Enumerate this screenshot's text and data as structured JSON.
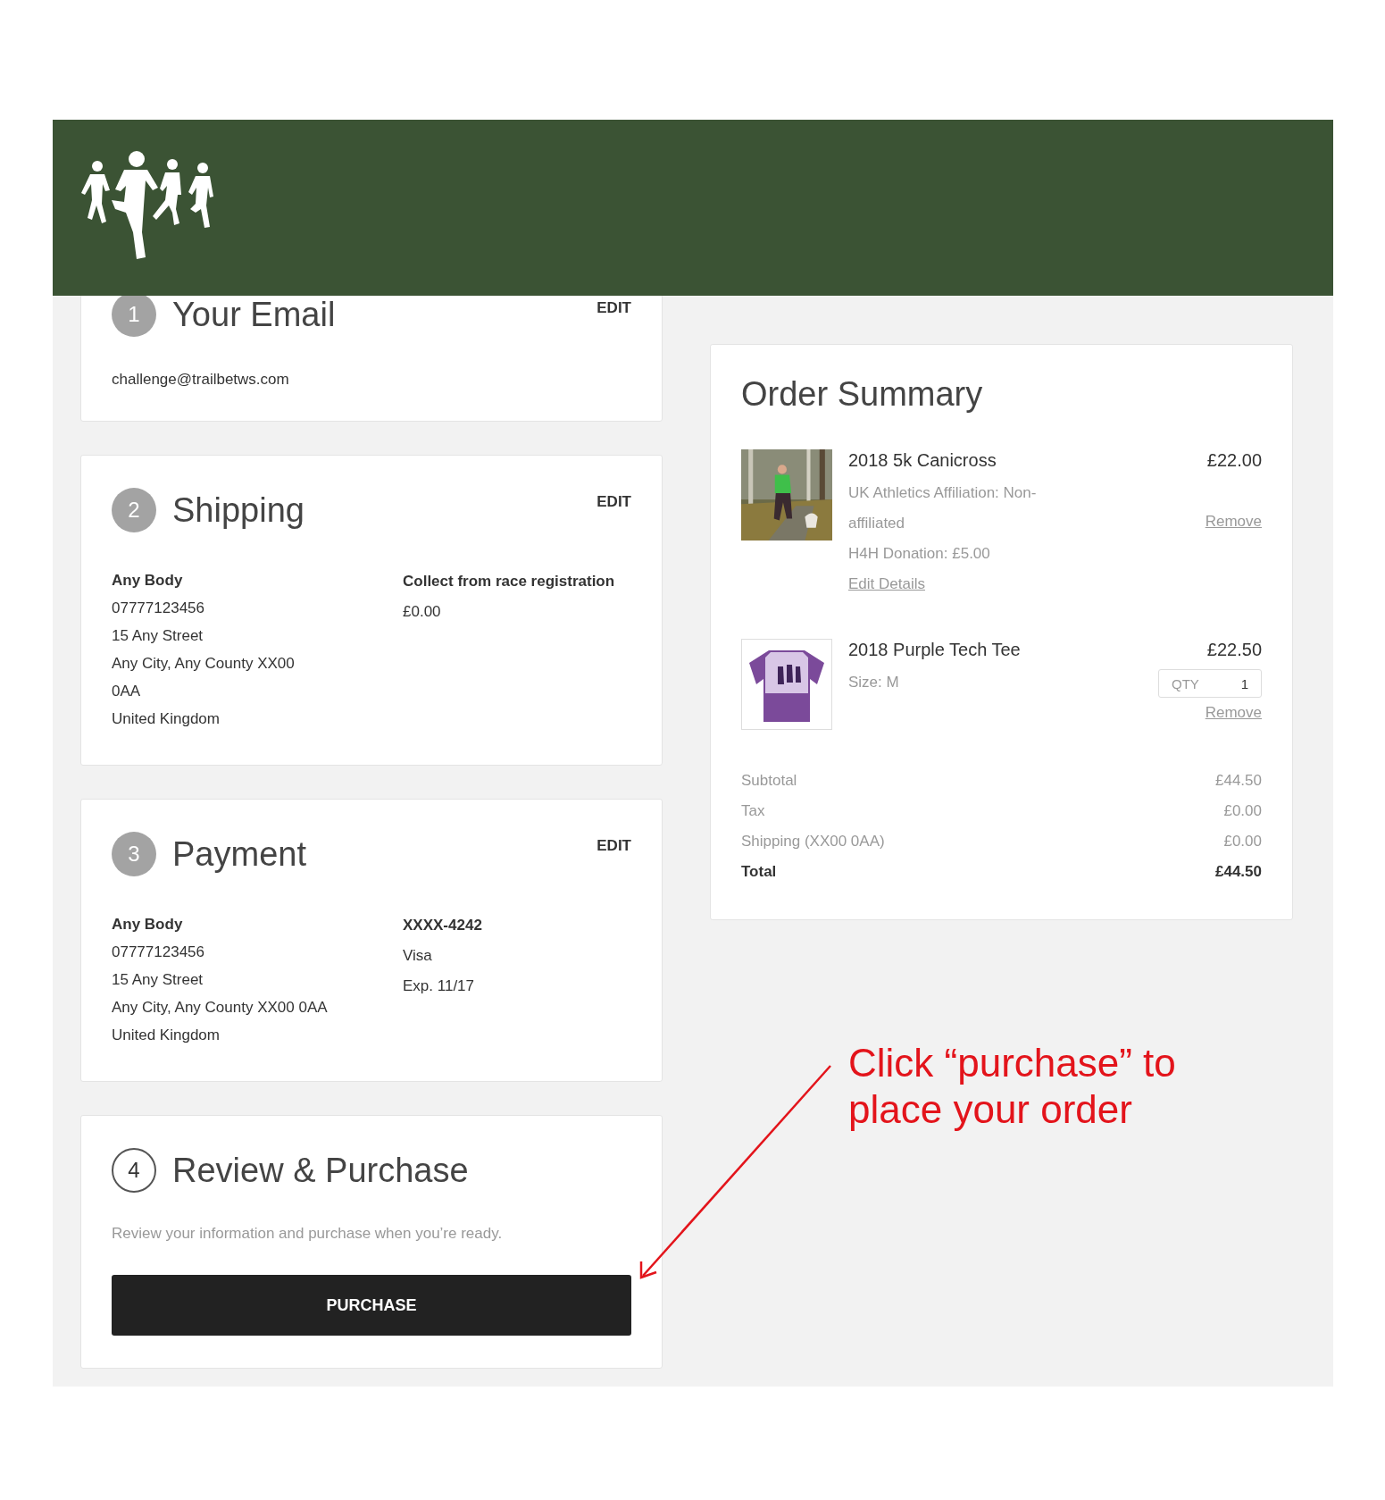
{
  "steps": [
    {
      "kind": "email",
      "number": "1",
      "title": "Your Email",
      "completed": true,
      "edit": "EDIT",
      "email": "challenge@trailbetws.com"
    },
    {
      "kind": "shipping",
      "number": "2",
      "title": "Shipping",
      "completed": true,
      "edit": "EDIT",
      "address": [
        "Any Body",
        "07777123456",
        "15 Any Street",
        "Any City, Any County XX00",
        "0AA",
        "United Kingdom"
      ],
      "method": "Collect from race registration",
      "cost": "£0.00"
    },
    {
      "kind": "payment",
      "number": "3",
      "title": "Payment",
      "completed": true,
      "edit": "EDIT",
      "address": [
        "Any Body",
        "07777123456",
        "15 Any Street",
        "Any City, Any County XX00 0AA",
        "United Kingdom"
      ],
      "card": "XXXX-4242",
      "brand": "Visa",
      "expiry": "Exp. 11/17"
    },
    {
      "kind": "review",
      "number": "4",
      "title": "Review & Purchase",
      "completed": false,
      "note": "Review your information and purchase when you’re ready.",
      "button": "PURCHASE"
    }
  ],
  "order_summary": {
    "title": "Order Summary",
    "items": [
      {
        "kind": "event",
        "name": "2018 5k Canicross",
        "price": "£22.00",
        "details": [
          "UK Athletics Affiliation: Non-affiliated",
          "H4H Donation: £5.00"
        ],
        "edit": "Edit Details",
        "remove": "Remove"
      },
      {
        "kind": "product",
        "name": "2018 Purple Tech Tee",
        "price": "£22.50",
        "details": [
          "Size: M"
        ],
        "qty_label": "QTY",
        "qty": "1",
        "remove": "Remove"
      }
    ],
    "totals": [
      {
        "kind": "line",
        "label": "Subtotal",
        "value": "£44.50"
      },
      {
        "kind": "line",
        "label": "Tax",
        "value": "£0.00"
      },
      {
        "kind": "line",
        "label": "Shipping (XX00 0AA)",
        "value": "£0.00"
      },
      {
        "kind": "total",
        "label": "Total",
        "value": "£44.50"
      }
    ]
  },
  "annotation": {
    "text": "Click “purchase” to place your order"
  }
}
